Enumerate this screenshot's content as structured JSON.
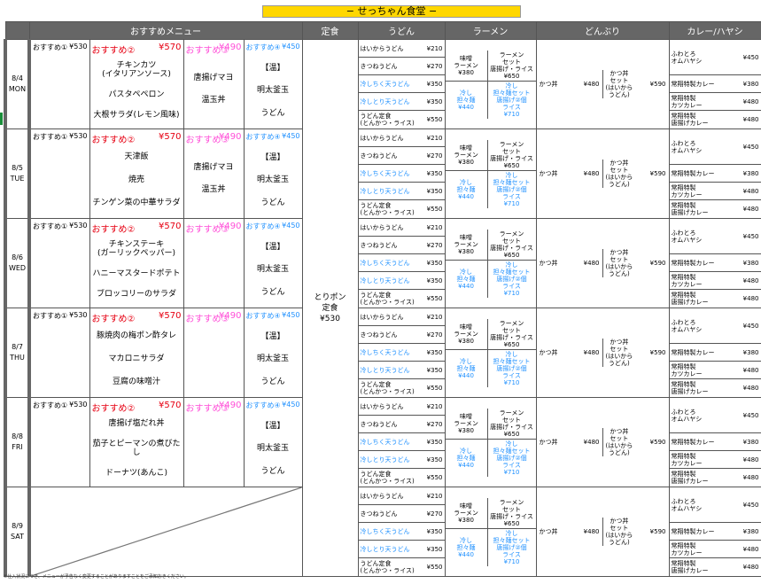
{
  "title": "− せっちゃん食堂 −",
  "headers": {
    "recommend": "おすすめメニュー",
    "teishoku": "定食",
    "udon": "うどん",
    "ramen": "ラーメン",
    "donburi": "どんぶり",
    "curry": "カレー/ハヤシ"
  },
  "teishoku": {
    "name": "とりポン\n定食",
    "price": "¥530"
  },
  "r1": {
    "label": "おすすめ①",
    "price": "¥530"
  },
  "r2": {
    "label": "おすすめ②",
    "price": "¥570"
  },
  "r3": {
    "label": "おすすめ③",
    "price": "¥490"
  },
  "r4": {
    "label": "おすすめ④",
    "price": "¥450"
  },
  "days": [
    {
      "date": "8/4",
      "dow": "MON",
      "r2": [
        "チキンカツ\n(イタリアンソース)",
        "パスタペペロン",
        "大根サラダ(レモン風味)"
      ],
      "r3": [
        "唐揚げマヨ",
        "温玉丼"
      ],
      "r4": [
        "【温】",
        "明太釜玉",
        "うどん"
      ]
    },
    {
      "date": "8/5",
      "dow": "TUE",
      "r2": [
        "天津飯",
        "焼売",
        "チンゲン菜の中華サラダ"
      ],
      "r3": [
        "唐揚げマヨ",
        "温玉丼"
      ],
      "r4": [
        "【温】",
        "明太釜玉",
        "うどん"
      ]
    },
    {
      "date": "8/6",
      "dow": "WED",
      "r2": [
        "チキンステーキ\n(ガーリックペッパー)",
        "ハニーマスタードポテト",
        "ブロッコリーのサラダ"
      ],
      "r3": [],
      "r4": [
        "【温】",
        "明太釜玉",
        "うどん"
      ]
    },
    {
      "date": "8/7",
      "dow": "THU",
      "r2": [
        "豚焼肉の梅ポン酢タレ",
        "マカロニサラダ",
        "豆腐の味噌汁"
      ],
      "r3": [],
      "r4": [
        "【温】",
        "明太釜玉",
        "うどん"
      ]
    },
    {
      "date": "8/8",
      "dow": "FRI",
      "r2": [
        "唐揚げ塩だれ丼",
        "茄子とピーマンの煮びたし",
        "ドーナツ(あんこ)"
      ],
      "r3": [],
      "r4": [
        "【温】",
        "明太釜玉",
        "うどん"
      ]
    },
    {
      "date": "8/9",
      "dow": "SAT",
      "closed": true
    }
  ],
  "udon": [
    {
      "name": "はいからうどん",
      "price": "¥210",
      "blue": false
    },
    {
      "name": "きつねうどん",
      "price": "¥270",
      "blue": false
    },
    {
      "name": "冷しちく天うどん",
      "price": "¥350",
      "blue": true
    },
    {
      "name": "冷しとり天うどん",
      "price": "¥350",
      "blue": true
    },
    {
      "name": "うどん定食\n(とんかつ・ライス)",
      "price": "¥550",
      "blue": false
    }
  ],
  "ramen": [
    {
      "text": "味噌\nラーメン\n¥380",
      "blue": false
    },
    {
      "text": "ラーメン\nセット\n唐揚げ・ライス\n¥650",
      "blue": false
    },
    {
      "text": "冷し\n担々麺\n¥440",
      "blue": true
    },
    {
      "text": "冷し\n担々麺セット\n唐揚げ②個\nライス\n¥710",
      "blue": true
    }
  ],
  "donburi": [
    {
      "name": "かつ丼",
      "price": "¥480"
    },
    {
      "name": "かつ丼\nセット\n(はいから\nうどん)",
      "price": "¥590"
    }
  ],
  "curry": [
    {
      "name": "ふわとろ\nオムハヤシ",
      "price": "¥450"
    },
    {
      "name": "常翔特製カレー",
      "price": "¥380"
    },
    {
      "name": "常翔特製\nカツカレー",
      "price": "¥480"
    },
    {
      "name": "常翔特製\n唐揚げカレー",
      "price": "¥480"
    }
  ],
  "footer": "※仕入状況につき、メニューが予告なく変更することがありますことをご承知おきください。"
}
